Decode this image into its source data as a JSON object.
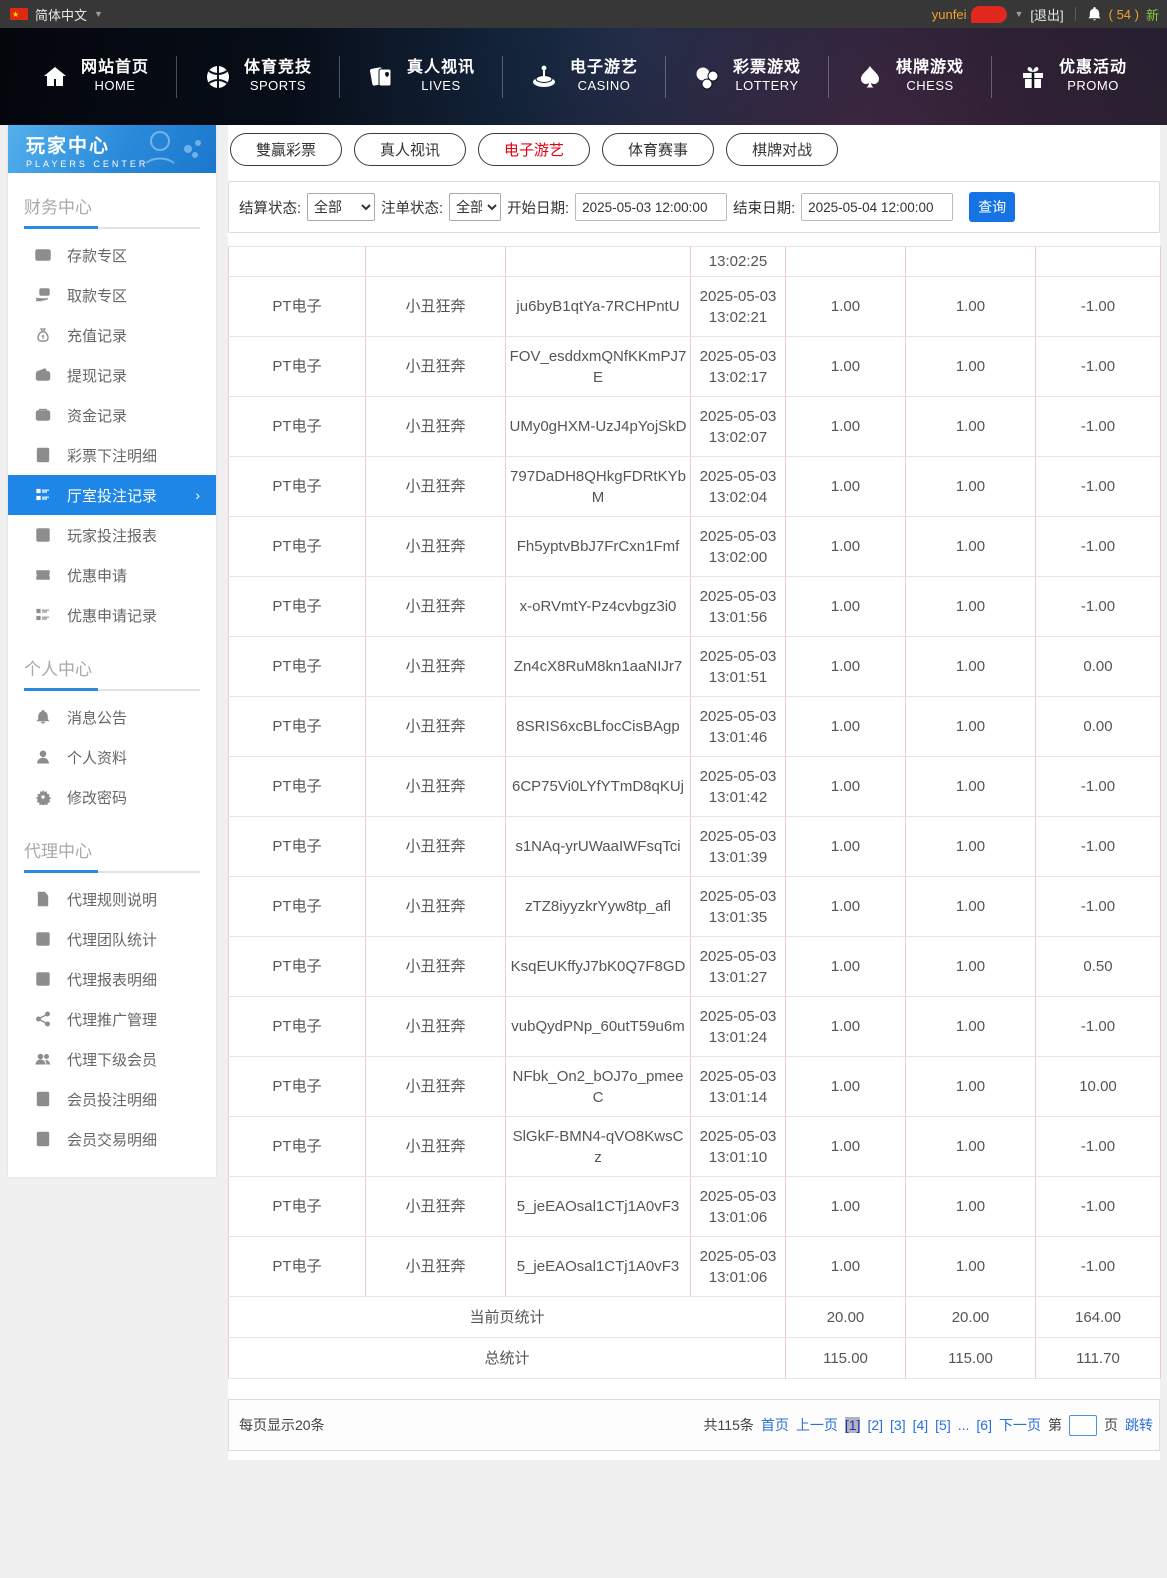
{
  "topbar": {
    "language": "简体中文",
    "username": "yunfei",
    "logout_label": "[退出]",
    "notice_count": "( 54 )",
    "notice_suffix": "新"
  },
  "nav": {
    "items": [
      {
        "zh": "网站首页",
        "en": "HOME",
        "icon": "home-icon"
      },
      {
        "zh": "体育竞技",
        "en": "SPORTS",
        "icon": "sports-ball-icon"
      },
      {
        "zh": "真人视讯",
        "en": "LIVES",
        "icon": "cards-icon"
      },
      {
        "zh": "电子游艺",
        "en": "CASINO",
        "icon": "roulette-icon"
      },
      {
        "zh": "彩票游戏",
        "en": "LOTTERY",
        "icon": "lottery-balls-icon"
      },
      {
        "zh": "棋牌游戏",
        "en": "CHESS",
        "icon": "spade-icon"
      },
      {
        "zh": "优惠活动",
        "en": "PROMO",
        "icon": "gift-icon"
      }
    ]
  },
  "sidebar": {
    "title": "玩家中心",
    "subtitle": "PLAYERS CENTER",
    "sections": {
      "finance": {
        "title": "财务中心",
        "items": [
          {
            "label": "存款专区",
            "icon": "deposit-card-icon"
          },
          {
            "label": "取款专区",
            "icon": "withdraw-hand-icon"
          },
          {
            "label": "充值记录",
            "icon": "moneybag-icon"
          },
          {
            "label": "提现记录",
            "icon": "wallet-out-icon"
          },
          {
            "label": "资金记录",
            "icon": "funds-icon"
          },
          {
            "label": "彩票下注明细",
            "icon": "doc-lines-icon"
          },
          {
            "label": "厅室投注记录",
            "icon": "list-detail-icon",
            "active": true,
            "chevron": "›"
          },
          {
            "label": "玩家投注报表",
            "icon": "report-chart-icon"
          },
          {
            "label": "优惠申请",
            "icon": "ticket-icon"
          },
          {
            "label": "优惠申请记录",
            "icon": "list-detail-icon"
          }
        ]
      },
      "personal": {
        "title": "个人中心",
        "items": [
          {
            "label": "消息公告",
            "icon": "bell-icon"
          },
          {
            "label": "个人资料",
            "icon": "person-icon"
          },
          {
            "label": "修改密码",
            "icon": "gear-icon"
          }
        ]
      },
      "agent": {
        "title": "代理中心",
        "items": [
          {
            "label": "代理规则说明",
            "icon": "doc-page-icon"
          },
          {
            "label": "代理团队统计",
            "icon": "report-chart-icon"
          },
          {
            "label": "代理报表明细",
            "icon": "report-chart-icon"
          },
          {
            "label": "代理推广管理",
            "icon": "share-icon"
          },
          {
            "label": "代理下级会员",
            "icon": "people-icon"
          },
          {
            "label": "会员投注明细",
            "icon": "doc-lines-icon"
          },
          {
            "label": "会员交易明细",
            "icon": "doc-lines-icon"
          }
        ]
      }
    }
  },
  "tabs": [
    {
      "label": "雙贏彩票"
    },
    {
      "label": "真人视讯"
    },
    {
      "label": "电子游艺",
      "active": true
    },
    {
      "label": "体育赛事"
    },
    {
      "label": "棋牌对战"
    }
  ],
  "filters": {
    "settle_label": "结算状态:",
    "settle_value": "全部",
    "order_label": "注单状态:",
    "order_value": "全部",
    "start_label": "开始日期:",
    "start_value": "2025-05-03 12:00:00",
    "end_label": "结束日期:",
    "end_value": "2025-05-04 12:00:00",
    "query_label": "查询"
  },
  "table": {
    "partial_time": "13:02:25",
    "rows": [
      {
        "platform": "PT电子",
        "game": "小丑狂奔",
        "bet_id": "ju6byB1qtYa-7RCHPntU",
        "datetime": "2025-05-03 13:02:21",
        "bet": "1.00",
        "valid": "1.00",
        "winloss": "-1.00"
      },
      {
        "platform": "PT电子",
        "game": "小丑狂奔",
        "bet_id": "FOV_esddxmQNfKKmPJ7E",
        "datetime": "2025-05-03 13:02:17",
        "bet": "1.00",
        "valid": "1.00",
        "winloss": "-1.00"
      },
      {
        "platform": "PT电子",
        "game": "小丑狂奔",
        "bet_id": "UMy0gHXM-UzJ4pYojSkD",
        "datetime": "2025-05-03 13:02:07",
        "bet": "1.00",
        "valid": "1.00",
        "winloss": "-1.00"
      },
      {
        "platform": "PT电子",
        "game": "小丑狂奔",
        "bet_id": "797DaDH8QHkgFDRtKYbM",
        "datetime": "2025-05-03 13:02:04",
        "bet": "1.00",
        "valid": "1.00",
        "winloss": "-1.00"
      },
      {
        "platform": "PT电子",
        "game": "小丑狂奔",
        "bet_id": "Fh5yptvBbJ7FrCxn1Fmf",
        "datetime": "2025-05-03 13:02:00",
        "bet": "1.00",
        "valid": "1.00",
        "winloss": "-1.00"
      },
      {
        "platform": "PT电子",
        "game": "小丑狂奔",
        "bet_id": "x-oRVmtY-Pz4cvbgz3i0",
        "datetime": "2025-05-03 13:01:56",
        "bet": "1.00",
        "valid": "1.00",
        "winloss": "-1.00"
      },
      {
        "platform": "PT电子",
        "game": "小丑狂奔",
        "bet_id": "Zn4cX8RuM8kn1aaNIJr7",
        "datetime": "2025-05-03 13:01:51",
        "bet": "1.00",
        "valid": "1.00",
        "winloss": "0.00"
      },
      {
        "platform": "PT电子",
        "game": "小丑狂奔",
        "bet_id": "8SRIS6xcBLfocCisBAgp",
        "datetime": "2025-05-03 13:01:46",
        "bet": "1.00",
        "valid": "1.00",
        "winloss": "0.00"
      },
      {
        "platform": "PT电子",
        "game": "小丑狂奔",
        "bet_id": "6CP75Vi0LYfYTmD8qKUj",
        "datetime": "2025-05-03 13:01:42",
        "bet": "1.00",
        "valid": "1.00",
        "winloss": "-1.00"
      },
      {
        "platform": "PT电子",
        "game": "小丑狂奔",
        "bet_id": "s1NAq-yrUWaaIWFsqTci",
        "datetime": "2025-05-03 13:01:39",
        "bet": "1.00",
        "valid": "1.00",
        "winloss": "-1.00"
      },
      {
        "platform": "PT电子",
        "game": "小丑狂奔",
        "bet_id": "zTZ8iyyzkrYyw8tp_afl",
        "datetime": "2025-05-03 13:01:35",
        "bet": "1.00",
        "valid": "1.00",
        "winloss": "-1.00"
      },
      {
        "platform": "PT电子",
        "game": "小丑狂奔",
        "bet_id": "KsqEUKffyJ7bK0Q7F8GD",
        "datetime": "2025-05-03 13:01:27",
        "bet": "1.00",
        "valid": "1.00",
        "winloss": "0.50"
      },
      {
        "platform": "PT电子",
        "game": "小丑狂奔",
        "bet_id": "vubQydPNp_60utT59u6m",
        "datetime": "2025-05-03 13:01:24",
        "bet": "1.00",
        "valid": "1.00",
        "winloss": "-1.00"
      },
      {
        "platform": "PT电子",
        "game": "小丑狂奔",
        "bet_id": "NFbk_On2_bOJ7o_pmeeC",
        "datetime": "2025-05-03 13:01:14",
        "bet": "1.00",
        "valid": "1.00",
        "winloss": "10.00"
      },
      {
        "platform": "PT电子",
        "game": "小丑狂奔",
        "bet_id": "SlGkF-BMN4-qVO8KwsCz",
        "datetime": "2025-05-03 13:01:10",
        "bet": "1.00",
        "valid": "1.00",
        "winloss": "-1.00"
      },
      {
        "platform": "PT电子",
        "game": "小丑狂奔",
        "bet_id": "5_jeEAOsal1CTj1A0vF3",
        "datetime": "2025-05-03 13:01:06",
        "bet": "1.00",
        "valid": "1.00",
        "winloss": "-1.00"
      },
      {
        "platform": "PT电子",
        "game": "小丑狂奔",
        "bet_id": "5_jeEAOsal1CTj1A0vF3",
        "datetime": "2025-05-03 13:01:06",
        "bet": "1.00",
        "valid": "1.00",
        "winloss": "-1.00"
      }
    ],
    "current_label": "当前页统计",
    "current_bet": "20.00",
    "current_valid": "20.00",
    "current_winloss": "164.00",
    "total_label": "总统计",
    "total_bet": "115.00",
    "total_valid": "115.00",
    "total_winloss": "111.70"
  },
  "pagination": {
    "per_page": "每页显示20条",
    "total_count": "共115条",
    "first_label": "首页",
    "prev_label": "上一页",
    "pages": [
      {
        "label": "[1]",
        "current": true
      },
      {
        "label": "[2]"
      },
      {
        "label": "[3]"
      },
      {
        "label": "[4]"
      },
      {
        "label": "[5]"
      },
      {
        "label": "..."
      },
      {
        "label": "[6]"
      }
    ],
    "next_label": "下一页",
    "jump_prefix": "第",
    "jump_suffix": "页",
    "jump_label": "跳转"
  }
}
